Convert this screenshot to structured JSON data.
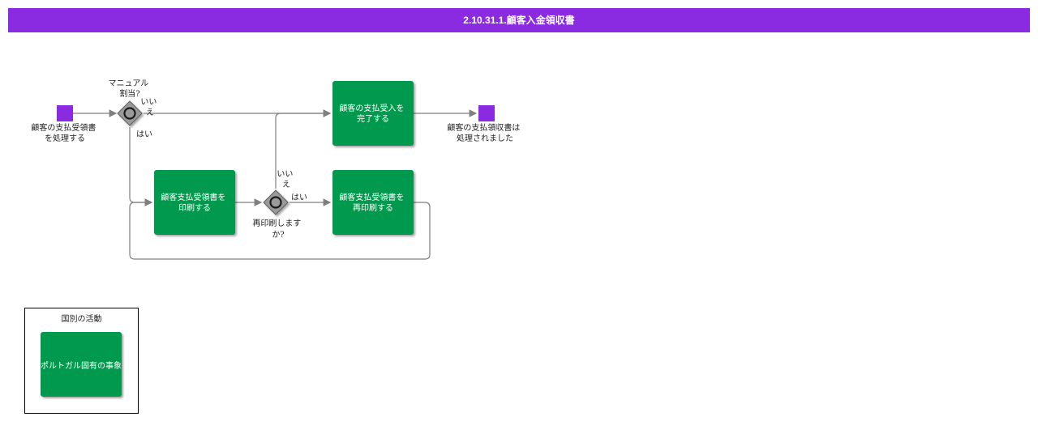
{
  "title": "2.10.31.1.顧客入金領収書",
  "colors": {
    "title_bar": "#8a2be2",
    "event": "#8a2be2",
    "task": "#00994d",
    "gateway": "#9a9a9a",
    "edge": "#7f7f7f"
  },
  "events": {
    "start": {
      "label_lines": [
        "顧客の支払受領書",
        "を処理する"
      ]
    },
    "end": {
      "label_lines": [
        "顧客の支払領収書は",
        "処理されました"
      ]
    }
  },
  "gateways": {
    "manual": {
      "label_lines": [
        "マニュアル",
        "割当?"
      ]
    },
    "reprint": {
      "label_lines": [
        "再印刷します",
        "か?"
      ]
    }
  },
  "tasks": {
    "complete": {
      "label_lines": [
        "顧客の支払受入を",
        "完了する"
      ]
    },
    "print": {
      "label_lines": [
        "顧客支払受領書を",
        "印刷する"
      ]
    },
    "reprint": {
      "label_lines": [
        "顧客支払受領書を",
        "再印刷する"
      ]
    }
  },
  "edges": {
    "manual_no": [
      "いい",
      "え"
    ],
    "manual_yes": "はい",
    "reprint_no": [
      "いい",
      "え"
    ],
    "reprint_yes": "はい"
  },
  "legend": {
    "title": "国別の活動",
    "task_label": "ポルトガル固有の事象"
  }
}
